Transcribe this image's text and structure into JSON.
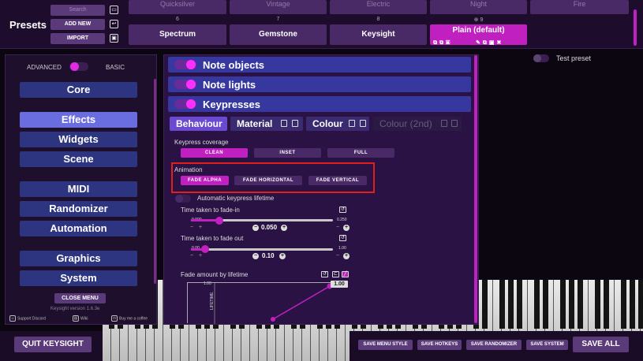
{
  "header": {
    "title": "Presets",
    "search_placeholder": "Search",
    "add_new_label": "ADD NEW",
    "import_label": "IMPORT",
    "top_row_presets": [
      "Quicksilver",
      "Vintage",
      "Electric",
      "Night",
      "Fire"
    ],
    "presets": [
      {
        "number": "6",
        "name": "Spectrum"
      },
      {
        "number": "7",
        "name": "Gemstone"
      },
      {
        "number": "8",
        "name": "Keysight"
      },
      {
        "number": "9",
        "name": "Plain (default)"
      }
    ]
  },
  "sidebar": {
    "advanced_label": "ADVANCED",
    "basic_label": "BASIC",
    "items": [
      "Core",
      "Effects",
      "Widgets",
      "Scene",
      "MIDI",
      "Randomizer",
      "Automation",
      "Graphics",
      "System"
    ],
    "active_item": "Effects",
    "close_menu_label": "CLOSE MENU",
    "version": "Keysight version 1.6.3e",
    "links": [
      "Support Discord",
      "Wiki",
      "Buy me a coffee"
    ]
  },
  "main": {
    "sections": [
      "Note objects",
      "Note lights",
      "Keypresses"
    ],
    "subtabs": [
      "Behaviour",
      "Material",
      "Colour",
      "Colour (2nd)"
    ],
    "coverage": {
      "label": "Keypress coverage",
      "options": [
        "CLEAN",
        "INSET",
        "FULL"
      ],
      "selected": "CLEAN"
    },
    "animation": {
      "label": "Animation",
      "options": [
        "FADE ALPHA",
        "FADE HORIZONTAL",
        "FADE VERTICAL"
      ],
      "selected": "FADE ALPHA"
    },
    "auto_lifetime_label": "Automatic keypress lifetime",
    "fade_in": {
      "label": "Time taken to fade-in",
      "min": "0.000",
      "max": "0.250",
      "value": "0.050"
    },
    "fade_out": {
      "label": "Time taken to fade out",
      "min": "0.00",
      "max": "1.00",
      "value": "0.10"
    },
    "fade_graph": {
      "label": "Fade amount by lifetime",
      "y_top": "1.00",
      "endpoint_value": "1.00",
      "axis_label": "LIFETIME"
    }
  },
  "test_preset_label": "Test preset",
  "footer": {
    "quit_label": "QUIT KEYSIGHT",
    "save_menu_style": "SAVE MENU STYLE",
    "save_hotkeys": "SAVE HOTKEYS",
    "save_randomizer": "SAVE RANDOMIZER",
    "save_system": "SAVE SYSTEM",
    "save_all": "SAVE ALL"
  },
  "colors": {
    "accent": "#c020c0",
    "nav": "#2e3580",
    "nav_active": "#6a6de0",
    "highlight": "#e0201a"
  },
  "icons": [
    "folder-icon",
    "import-icon",
    "save-icon",
    "copy-icon",
    "paste-icon",
    "delete-icon",
    "reset-icon",
    "discord-icon",
    "wiki-icon",
    "coffee-icon"
  ]
}
